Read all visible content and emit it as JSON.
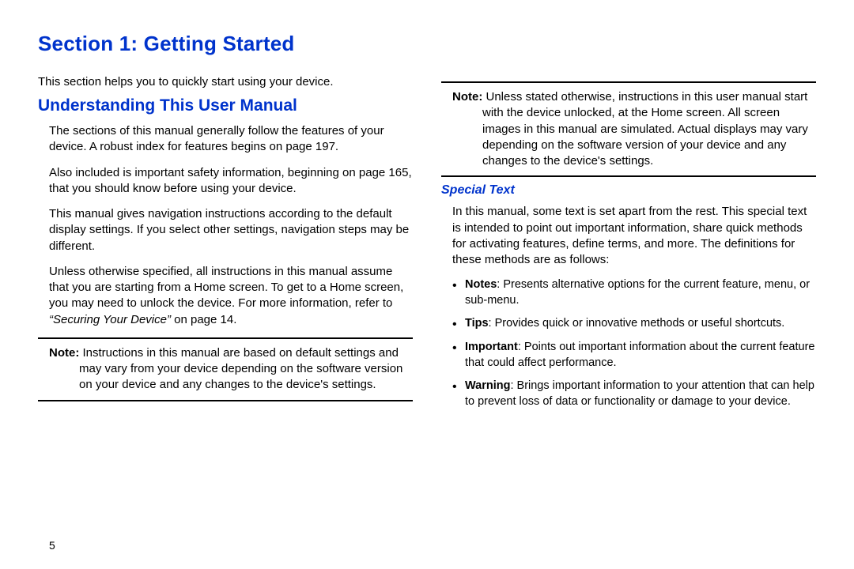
{
  "title": "Section 1: Getting Started",
  "intro": "This section helps you to quickly start using your device.",
  "subheading": "Understanding This User Manual",
  "paras": [
    "The sections of this manual generally follow the features of your device. A robust index for features begins on page 197.",
    "Also included is important safety information, beginning on page 165, that you should know before using your device.",
    "This manual gives navigation instructions according to the default display settings. If you select other settings, navigation steps may be different."
  ],
  "para4_pre": "Unless otherwise specified, all instructions in this manual assume that you are starting from a Home screen. To get to a Home screen, you may need to unlock the device. For more information, refer to ",
  "para4_italic": "“Securing Your Device”",
  "para4_post": " on page 14.",
  "note1_label": "Note:",
  "note1_body": " Instructions in this manual are based on default settings and may vary from your device depending on the software version on your device and any changes to the device's settings.",
  "note2_label": "Note:",
  "note2_body": " Unless stated otherwise, instructions in this user manual start with the device unlocked, at the Home screen. All screen images in this manual are simulated. Actual displays may vary depending on the software version of your device and any changes to the device's settings.",
  "special_heading": "Special Text",
  "special_para": "In this manual, some text is set apart from the rest. This special text is intended to point out important information, share quick methods for activating features, define terms, and more. The definitions for these methods are as follows:",
  "bullets": [
    {
      "label": "Notes",
      "text": ": Presents alternative options for the current feature, menu, or sub-menu."
    },
    {
      "label": "Tips",
      "text": ": Provides quick or innovative methods or useful shortcuts."
    },
    {
      "label": "Important",
      "text": ": Points out important information about the current feature that could affect performance."
    },
    {
      "label": "Warning",
      "text": ": Brings important information to your attention that can help to prevent loss of data or functionality or damage to your device."
    }
  ],
  "page_number": "5"
}
